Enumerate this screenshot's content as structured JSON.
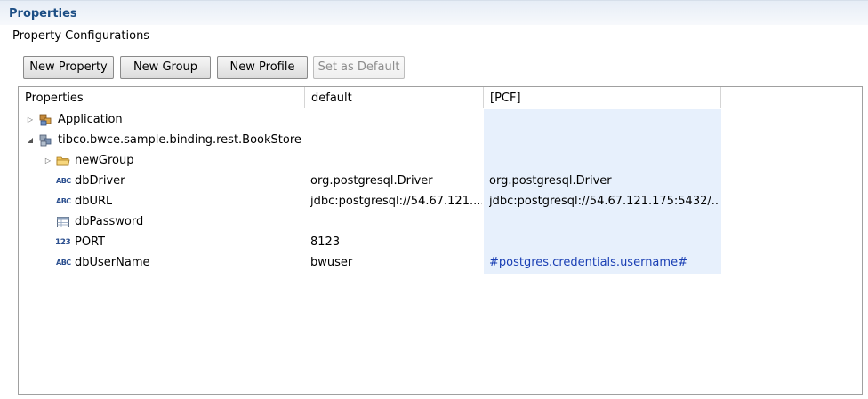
{
  "panel": {
    "title": "Properties",
    "section_label": "Property Configurations"
  },
  "toolbar": {
    "new_property": "New Property",
    "new_group": "New Group",
    "new_profile": "New Profile",
    "set_as_default": "Set as Default"
  },
  "table": {
    "columns": [
      "Properties",
      "default",
      "[PCF]"
    ],
    "rows": [
      {
        "name": "Application",
        "icon": "application-icon",
        "default": "",
        "pcf": ""
      },
      {
        "name": "tibco.bwce.sample.binding.rest.BookStore",
        "icon": "module-icon",
        "default": "",
        "pcf": ""
      },
      {
        "name": "newGroup",
        "icon": "folder-icon",
        "default": "",
        "pcf": ""
      },
      {
        "name": "dbDriver",
        "icon": "string-type-icon",
        "default": "org.postgresql.Driver",
        "pcf": "org.postgresql.Driver"
      },
      {
        "name": "dbURL",
        "icon": "string-type-icon",
        "default": "jdbc:postgresql://54.67.121....",
        "pcf": "jdbc:postgresql://54.67.121.175:5432/..."
      },
      {
        "name": "dbPassword",
        "icon": "password-type-icon",
        "default": "",
        "pcf": ""
      },
      {
        "name": "PORT",
        "icon": "integer-type-icon",
        "default": "8123",
        "pcf": ""
      },
      {
        "name": "dbUserName",
        "icon": "string-type-icon",
        "default": "bwuser",
        "pcf": "#postgres.credentials.username#"
      }
    ]
  },
  "colors": {
    "pcf_column_bg": "#e7f0fc",
    "link_text": "#1a3fb4",
    "title_text": "#1d4f85"
  }
}
